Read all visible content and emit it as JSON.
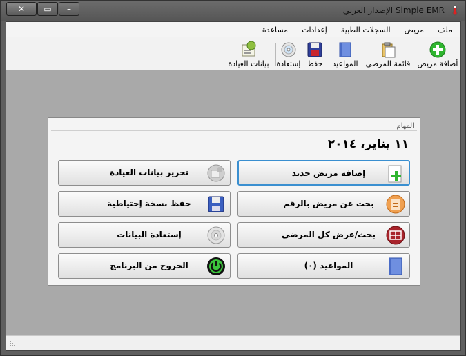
{
  "window": {
    "title": "Simple EMR الإصدار العربي"
  },
  "menu": {
    "items": [
      "ملف",
      "مريض",
      "السجلات الطبية",
      "إعدادات",
      "مساعدة"
    ]
  },
  "toolbar": {
    "items": [
      {
        "label": "أضافة مريض",
        "icon": "add-patient-icon"
      },
      {
        "label": "قائمة المرضي",
        "icon": "clipboard-icon"
      },
      {
        "label": "المواعيد",
        "icon": "appointments-book-icon"
      },
      {
        "label": "حفظ",
        "icon": "floppy-disk-icon"
      },
      {
        "label": "إستعادة",
        "icon": "cd-disc-icon"
      },
      {
        "label": "بيانات العيادة",
        "icon": "clinic-settings-icon"
      }
    ]
  },
  "tasks": {
    "title": "المهام",
    "date": "١١ يناير، ٢٠١٤",
    "buttons": [
      {
        "label": "إضافة مريض جديد",
        "icon": "add-document-icon"
      },
      {
        "label": "تحرير بيانات العيادة",
        "icon": "clinic-settings-icon"
      },
      {
        "label": "بحث عن مريض بالرقم",
        "icon": "search-id-icon"
      },
      {
        "label": "حفظ نسخة إحتياطية",
        "icon": "floppy-disk-icon"
      },
      {
        "label": "بحث/عرض كل المرضي",
        "icon": "patients-grid-icon"
      },
      {
        "label": "إستعادة البيانات",
        "icon": "cd-disc-icon"
      },
      {
        "label": "المواعيد (٠)",
        "icon": "appointments-book-icon"
      },
      {
        "label": "الخروج من البرنامج",
        "icon": "power-icon"
      }
    ]
  },
  "colors": {
    "accent": "#3a8fd0",
    "green": "#2fb52f",
    "panel": "#f4f4f4",
    "workspace": "#a9a9a9"
  }
}
